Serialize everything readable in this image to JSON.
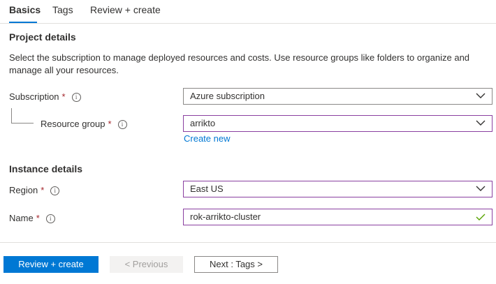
{
  "tabs": [
    {
      "label": "Basics",
      "active": true
    },
    {
      "label": "Tags",
      "active": false
    },
    {
      "label": "Review + create",
      "active": false
    }
  ],
  "project_details": {
    "title": "Project details",
    "description": "Select the subscription to manage deployed resources and costs. Use resource groups like folders to organize and manage all your resources.",
    "subscription": {
      "label": "Subscription",
      "required_mark": "*",
      "value": "Azure subscription"
    },
    "resource_group": {
      "label": "Resource group",
      "required_mark": "*",
      "value": "arrikto",
      "create_new": "Create new"
    }
  },
  "instance_details": {
    "title": "Instance details",
    "region": {
      "label": "Region",
      "required_mark": "*",
      "value": "East US"
    },
    "name": {
      "label": "Name",
      "required_mark": "*",
      "value": "rok-arrikto-cluster",
      "valid": true
    }
  },
  "footer": {
    "review_create": "Review + create",
    "previous": "< Previous",
    "next": "Next : Tags >"
  },
  "info_glyph": "i",
  "colors": {
    "accent": "#0078d4",
    "required": "#a4262c",
    "focus_border": "#8a3fa0",
    "valid_check": "#57a300"
  },
  "icons": [
    "info-icon",
    "chevron-down-icon",
    "check-icon"
  ]
}
